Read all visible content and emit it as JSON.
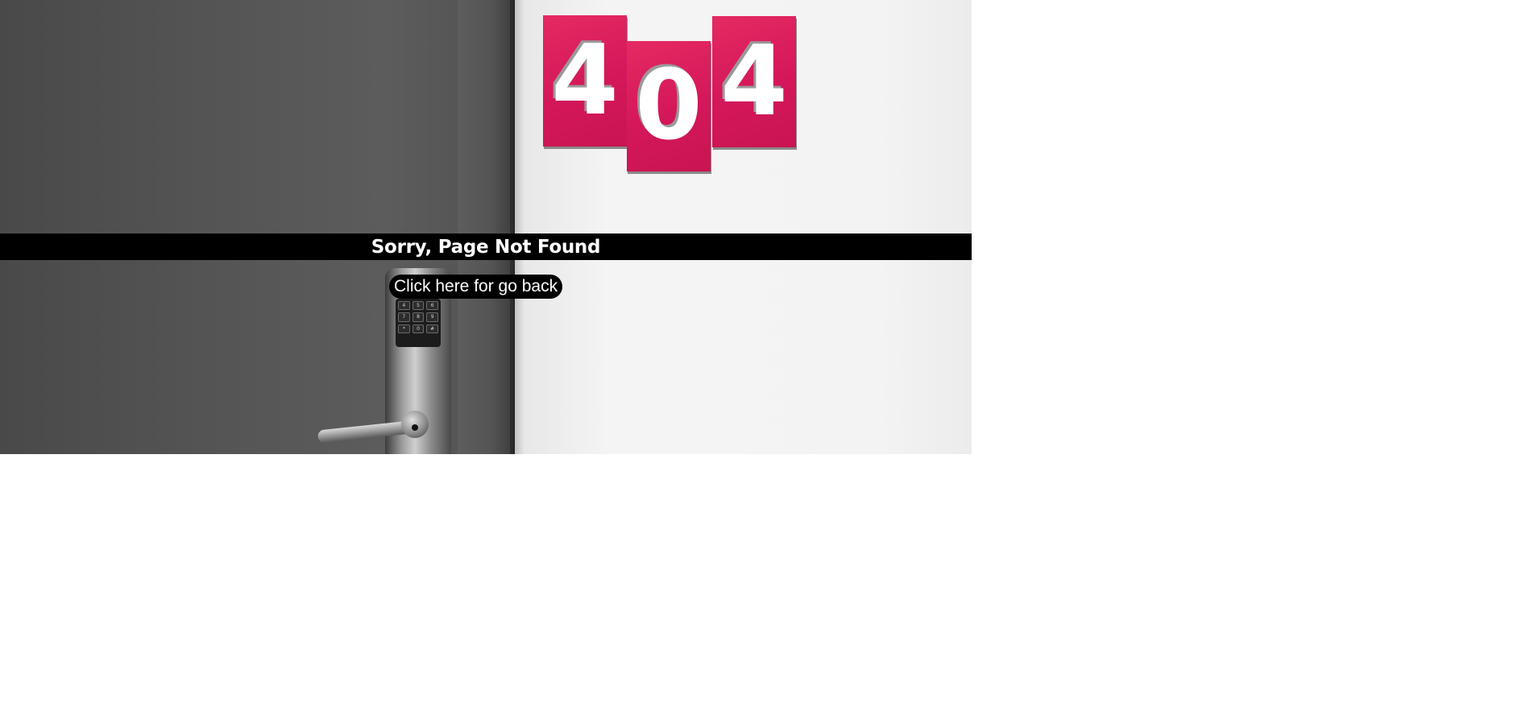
{
  "sign": {
    "digits": [
      "4",
      "0",
      "4"
    ]
  },
  "banner": {
    "title": "Sorry, Page Not Found"
  },
  "actions": {
    "go_back_label": "Click here for go back"
  },
  "keypad": {
    "keys": [
      "4",
      "5",
      "6",
      "7",
      "8",
      "9",
      "*",
      "0",
      "#"
    ]
  },
  "colors": {
    "sign_red": "#d4175a",
    "banner_bg": "#000000",
    "text": "#ffffff"
  }
}
